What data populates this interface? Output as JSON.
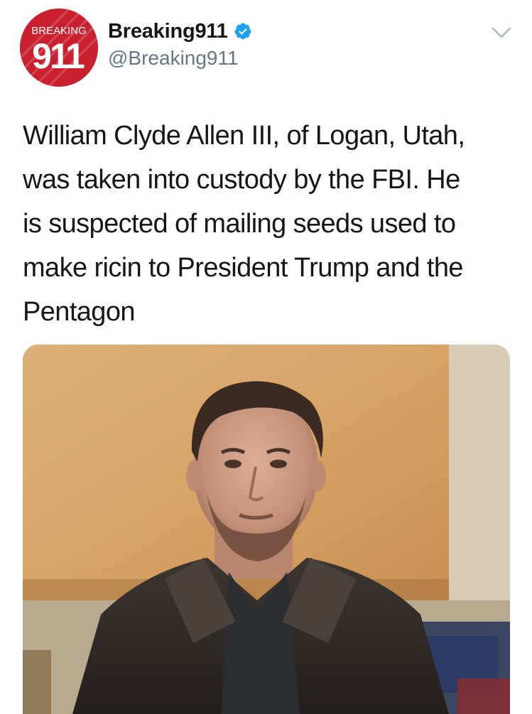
{
  "tweet": {
    "avatar": {
      "icon": "breaking911-logo",
      "text_top": "BREAKING",
      "text_main": "911",
      "color": "#c8202f"
    },
    "display_name": "Breaking911",
    "verified_icon": "verified-badge-icon",
    "handle": "@Breaking911",
    "menu_icon": "chevron-down-icon",
    "text": "William Clyde Allen III, of Logan, Utah,\nwas taken into custody by the FBI. He\nis suspected of mailing seeds used to\nmake ricin to President Trump and the\nPentagon",
    "media": {
      "type": "photo",
      "subject": "man-portrait"
    }
  },
  "colors": {
    "text": "#14171a",
    "secondary": "#657786",
    "verified": "#1da1f2",
    "brand": "#c8202f"
  }
}
